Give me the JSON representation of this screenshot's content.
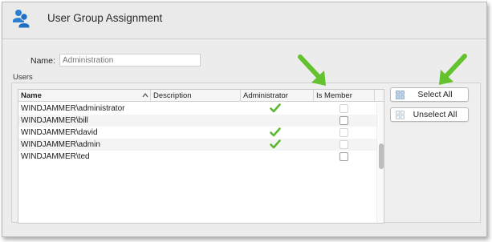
{
  "window": {
    "title": "User Group Assignment",
    "app_icon": "users-group-icon"
  },
  "form": {
    "name_label": "Name:",
    "name_placeholder": "Administration"
  },
  "users": {
    "section_label": "Users",
    "columns": [
      "Name",
      "Description",
      "Administrator",
      "Is Member"
    ],
    "sort_column": "Name",
    "sort_direction": "ascending",
    "rows": [
      {
        "name": "WINDJAMMER\\administrator",
        "description": "",
        "administrator": true,
        "is_member": false
      },
      {
        "name": "WINDJAMMER\\bill",
        "description": "",
        "administrator": false,
        "is_member": false
      },
      {
        "name": "WINDJAMMER\\david",
        "description": "",
        "administrator": true,
        "is_member": false
      },
      {
        "name": "WINDJAMMER\\admin",
        "description": "",
        "administrator": true,
        "is_member": false
      },
      {
        "name": "WINDJAMMER\\ted",
        "description": "",
        "administrator": false,
        "is_member": false
      }
    ]
  },
  "buttons": {
    "select_all": "Select All",
    "unselect_all": "Unselect All"
  },
  "colors": {
    "check_green": "#5cb833",
    "arrow_green": "#63c22e",
    "icon_blue": "#2a7fd4"
  }
}
